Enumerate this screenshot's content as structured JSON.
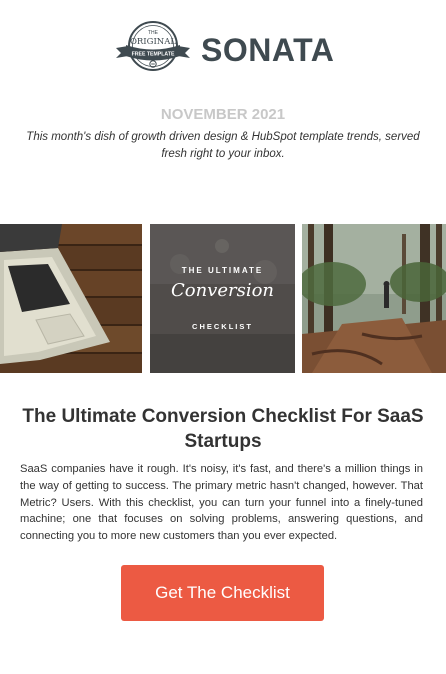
{
  "header": {
    "badge": {
      "top_small": "THE",
      "top_word": "ORIGINAL",
      "ribbon": "FREE TEMPLATE"
    },
    "brand": "SONATA"
  },
  "intro": {
    "month": "NOVEMBER 2021",
    "tagline": "This month's dish of growth driven design & HubSpot template trends, served fresh right to your inbox."
  },
  "images": {
    "checklist_line1": "THE ULTIMATE",
    "checklist_line2": "Conversion",
    "checklist_line3": "CHECKLIST"
  },
  "article": {
    "headline": "The Ultimate Conversion Checklist For SaaS Startups",
    "body": "SaaS companies have it rough. It's noisy, it's fast, and there's a million things in the way of getting to success. The primary metric hasn't changed, however. That Metric? Users. With this checklist, you can turn your funnel into a finely-tuned machine; one that focuses on solving problems, answering questions, and connecting you to more new customers than you ever expected.",
    "cta_label": "Get The Checklist"
  },
  "colors": {
    "brand": "#3f4a50",
    "month": "#c8c8c8",
    "cta": "#ec5a43"
  }
}
